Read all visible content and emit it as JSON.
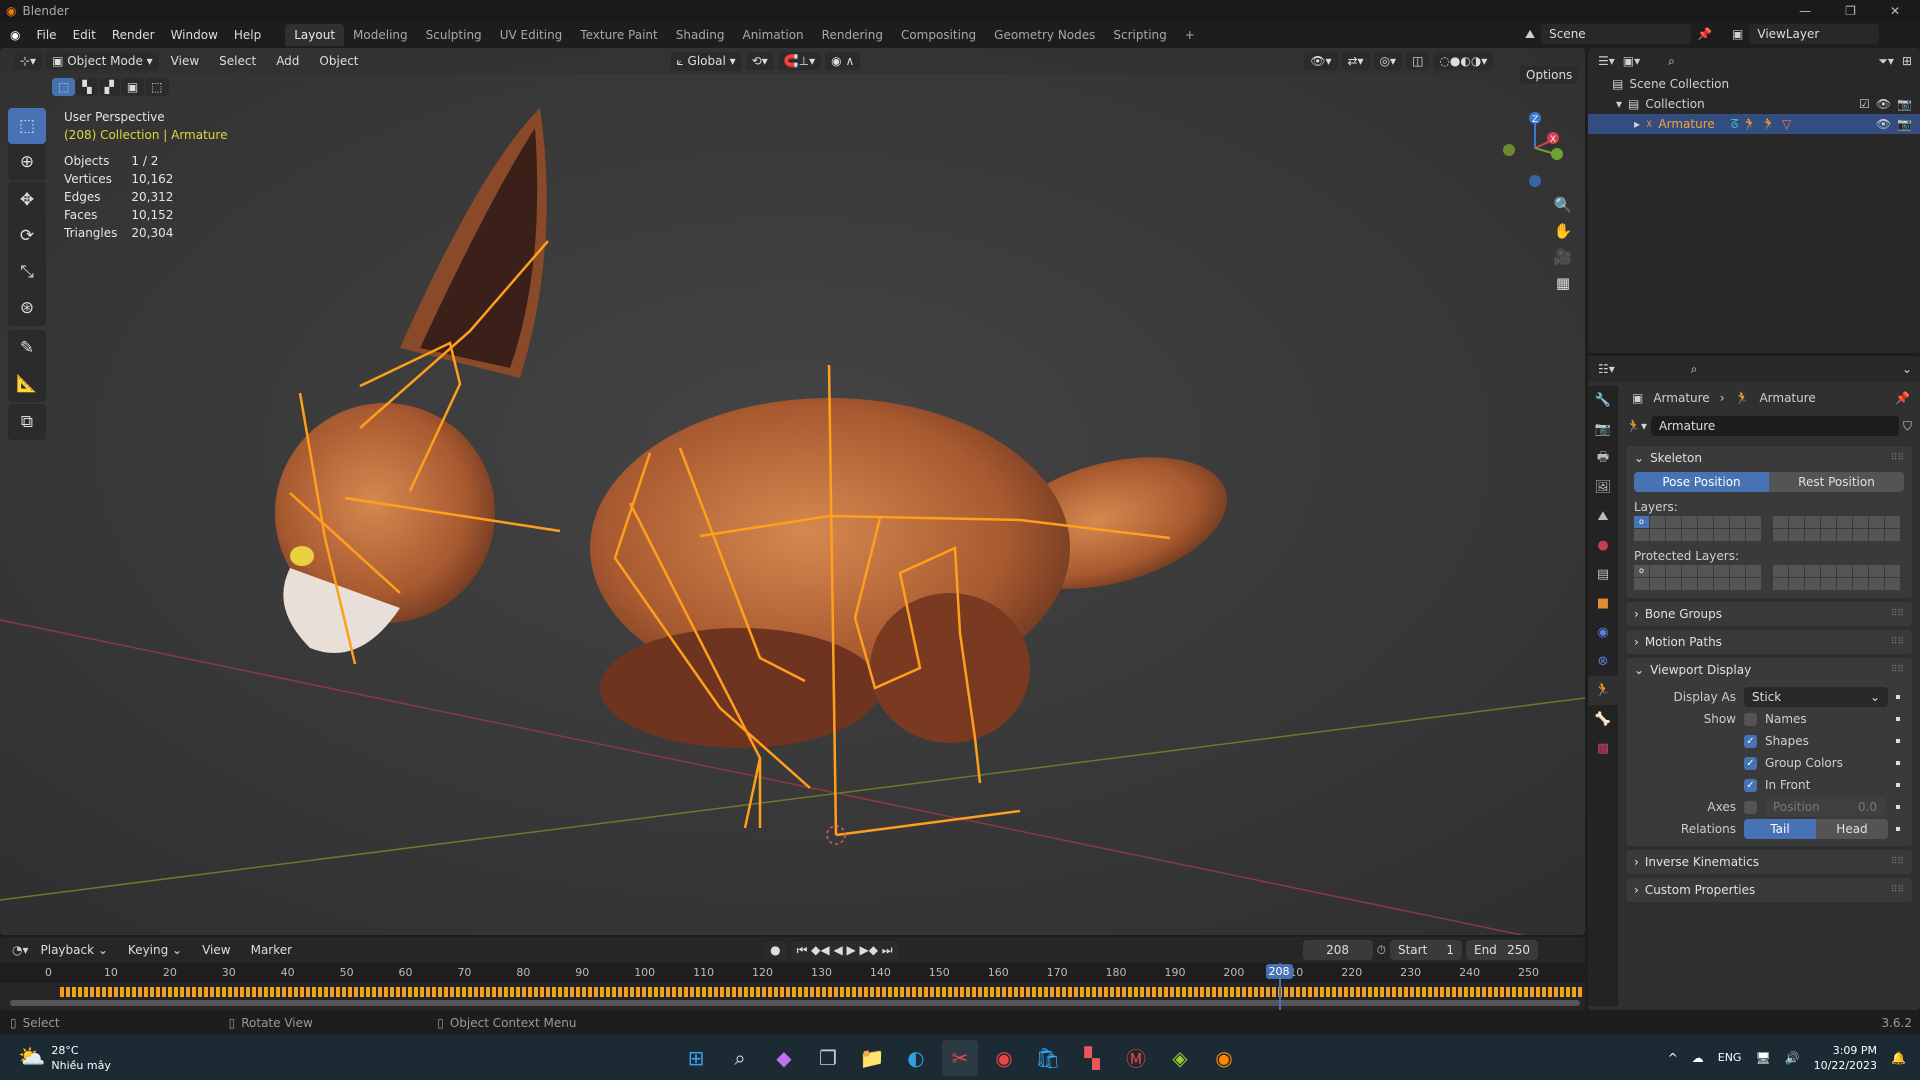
{
  "title_bar": {
    "app": "Blender"
  },
  "top_menu": {
    "items": [
      "File",
      "Edit",
      "Render",
      "Window",
      "Help"
    ],
    "workspaces": [
      "Layout",
      "Modeling",
      "Sculpting",
      "UV Editing",
      "Texture Paint",
      "Shading",
      "Animation",
      "Rendering",
      "Compositing",
      "Geometry Nodes",
      "Scripting",
      "+"
    ],
    "active_workspace": "Layout",
    "scene": "Scene",
    "view_layer": "ViewLayer"
  },
  "viewport_header": {
    "mode": "Object Mode",
    "menus": [
      "View",
      "Select",
      "Add",
      "Object"
    ],
    "orientation": "Global",
    "options": "Options"
  },
  "viewport": {
    "perspective": "User Perspective",
    "context": "(208) Collection | Armature",
    "stats": [
      {
        "label": "Objects",
        "value": "1 / 2"
      },
      {
        "label": "Vertices",
        "value": "10,162"
      },
      {
        "label": "Edges",
        "value": "20,312"
      },
      {
        "label": "Faces",
        "value": "10,152"
      },
      {
        "label": "Triangles",
        "value": "20,304"
      }
    ],
    "gizmo": {
      "z": "Z",
      "x": "X"
    },
    "colors": {
      "bone": "#ff9f1c",
      "axis_x": "#c0404a",
      "axis_y": "#7a9a2a",
      "fur": "#b8643a"
    }
  },
  "outliner": {
    "rows": [
      {
        "label": "Scene Collection"
      },
      {
        "label": "Collection"
      },
      {
        "label": "Armature"
      }
    ]
  },
  "properties": {
    "breadcrumb": [
      "Armature",
      "Armature"
    ],
    "datablock": "Armature",
    "skeleton": {
      "title": "Skeleton",
      "pose": "Pose Position",
      "rest": "Rest Position",
      "layers": "Layers:",
      "protected": "Protected Layers:"
    },
    "collapsed": [
      "Bone Groups",
      "Motion Paths"
    ],
    "viewport_display": {
      "title": "Viewport Display",
      "display_as_label": "Display As",
      "display_as": "Stick",
      "show_label": "Show",
      "checks": [
        {
          "label": "Names",
          "checked": false
        },
        {
          "label": "Shapes",
          "checked": true
        },
        {
          "label": "Group Colors",
          "checked": true
        },
        {
          "label": "In Front",
          "checked": true
        }
      ],
      "axes_label": "Axes",
      "axes_position_label": "Position",
      "axes_position": "0.0",
      "relations_label": "Relations",
      "relations": [
        "Tail",
        "Head"
      ],
      "relations_active": "Tail"
    },
    "collapsed2": [
      "Inverse Kinematics",
      "Custom Properties"
    ]
  },
  "timeline": {
    "menus": [
      "Playback",
      "Keying",
      "View",
      "Marker"
    ],
    "current_frame": "208",
    "start_label": "Start",
    "start": "1",
    "end_label": "End",
    "end": "250",
    "ticks": [
      "0",
      "10",
      "20",
      "30",
      "40",
      "50",
      "60",
      "70",
      "80",
      "90",
      "100",
      "110",
      "120",
      "130",
      "140",
      "150",
      "160",
      "170",
      "180",
      "190",
      "200",
      "210",
      "220",
      "230",
      "240",
      "250"
    ]
  },
  "status_bar": {
    "items": [
      "Select",
      "Rotate View",
      "Object Context Menu"
    ],
    "version": "3.6.2"
  },
  "taskbar": {
    "temp": "28°C",
    "weather": "Nhiều mây",
    "lang": "ENG",
    "time": "3:09 PM",
    "date": "10/22/2023"
  }
}
